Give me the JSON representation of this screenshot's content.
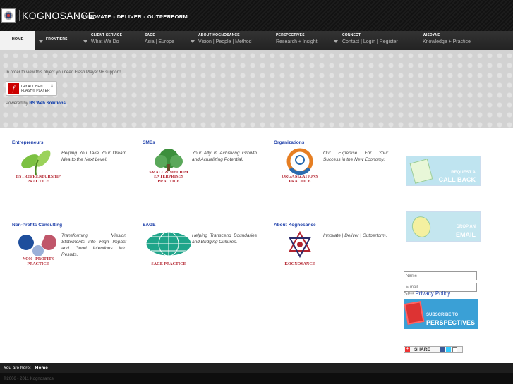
{
  "header": {
    "brand": "KOGNOSANCE",
    "tagline": "INNOVATE - DELIVER - OUTPERFORM"
  },
  "nav": {
    "home": "HOME",
    "items": [
      {
        "title": "FRONTIERS",
        "sub": ""
      },
      {
        "title": "CLIENT SERVICE",
        "sub": "What We Do"
      },
      {
        "title": "SAGE",
        "sub": "Asia | Europe"
      },
      {
        "title": "ABOUT KOGNOSANCE",
        "sub": "Vision | People | Method"
      },
      {
        "title": "PERSPECTIVES",
        "sub": "Research + Insight"
      },
      {
        "title": "CONNECT",
        "sub": "Contact | Login | Register"
      },
      {
        "title": "WISDYNE",
        "sub": "Knowledge + Practice"
      }
    ]
  },
  "banner": {
    "flash_notice": "In order to view this object you need Flash Player 9+ support!",
    "flash_button_line1": "Get ADOBE®",
    "flash_button_line2": "FLASH® PLAYER",
    "powered_prefix": "Powered by",
    "powered_link": "RS Web Solutions"
  },
  "practices": [
    {
      "title": "Entrepreneurs",
      "desc": "Helping You Take Your Dream Idea to the Next Level.",
      "img_label": "ENTREPRENEURSHIP PRACTICE",
      "icon": "leaf-icon"
    },
    {
      "title": "SMEs",
      "desc": "Your Ally in Achieving Growth and Actualizing Potential.",
      "img_label": "SMALL & MEDIUM ENTERPRISES PRACTICE",
      "icon": "tree-icon"
    },
    {
      "title": "Organizations",
      "desc": "Our Expertise For Your Success in the New Economy.",
      "img_label": "ORGANIZATIONS PRACTICE",
      "icon": "ring-icon"
    },
    {
      "title": "Non-Profits Consulting",
      "desc": "Transforming Mission Statements into High Impact and Good Intentions into Results.",
      "img_label": "NON - PROFITS PRACTICE",
      "icon": "people-icon"
    },
    {
      "title": "SAGE",
      "desc": "Helping Transcend Boundaries and Bridging Cultures.",
      "img_label": "SAGE PRACTICE",
      "icon": "globe-icon"
    },
    {
      "title": "About Kognosance",
      "desc": "Innovate | Deliver | Outperform.",
      "img_label": "KOGNOSANCE",
      "icon": "star-emblem-icon"
    }
  ],
  "sidebar": {
    "callback_small": "REQUEST A",
    "callback_big": "CALL BACK",
    "email_small": "DROP AN",
    "email_big": "EMAIL",
    "name_placeholder": "Name",
    "email_placeholder": "E-mail",
    "see": "See",
    "privacy": "Privacy Policy",
    "subscribe_small": "SUBSCRIBE TO",
    "subscribe_big": "PERSPECTIVES",
    "share": "SHARE"
  },
  "footer": {
    "you_are_here": "You are here:",
    "crumb": "Home",
    "copyright": "©2006 - 2011 Kognosance"
  },
  "colors": {
    "link_blue": "#1a3ca8",
    "practice_red": "#b3242f",
    "sidebar_blue": "#3aa0d6"
  }
}
